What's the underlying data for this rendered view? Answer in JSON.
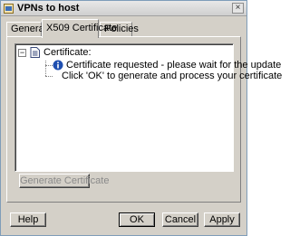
{
  "window": {
    "title": "VPNs to host",
    "close_glyph": "×"
  },
  "tabs": [
    {
      "label": "General",
      "active": false
    },
    {
      "label": "X509 Certificate",
      "active": true
    },
    {
      "label": "Policies",
      "active": false
    }
  ],
  "tree": {
    "expander_glyph": "−",
    "root_label": "Certificate:",
    "children": [
      {
        "icon": "info-icon",
        "label": "Certificate requested - please wait for the update"
      },
      {
        "icon": "",
        "label": "Click 'OK' to generate and process your certificate"
      }
    ]
  },
  "buttons": {
    "generate_certificate": "Generate Certificate",
    "help": "Help",
    "ok": "OK",
    "cancel": "Cancel",
    "apply": "Apply"
  },
  "colors": {
    "dialog_bg": "#d4d0c8",
    "info_blue": "#1f4fb0"
  }
}
